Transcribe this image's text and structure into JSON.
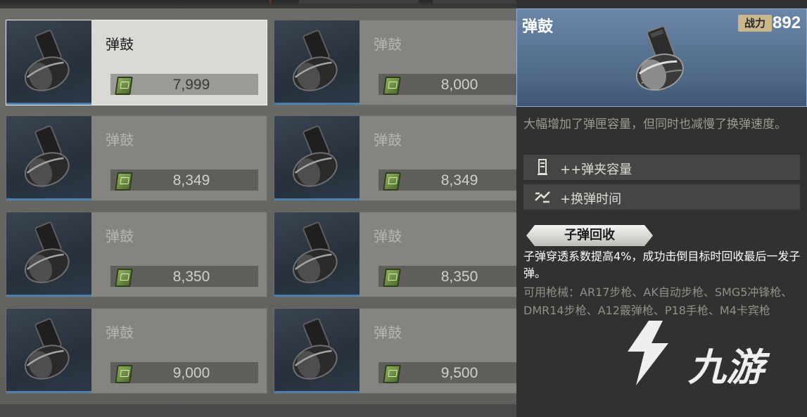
{
  "shop": {
    "items": [
      {
        "name": "弹鼓",
        "price": "7,999",
        "selected": true
      },
      {
        "name": "弹鼓",
        "price": "8,000",
        "selected": false
      },
      {
        "name": "弹鼓",
        "price": "8,349",
        "selected": false
      },
      {
        "name": "弹鼓",
        "price": "8,349",
        "selected": false
      },
      {
        "name": "弹鼓",
        "price": "8,350",
        "selected": false
      },
      {
        "name": "弹鼓",
        "price": "8,350",
        "selected": false
      },
      {
        "name": "弹鼓",
        "price": "9,000",
        "selected": false
      },
      {
        "name": "弹鼓",
        "price": "9,500",
        "selected": false
      }
    ],
    "currency_icon": "cash-icon",
    "item_icon": "drum-magazine-icon"
  },
  "detail": {
    "title": "弹鼓",
    "power_label": "战力",
    "power_value": "892",
    "description": "大幅增加了弹匣容量，但同时也减慢了换弹速度。",
    "attributes": [
      {
        "icon": "magazine-icon",
        "label": "++弹夹容量"
      },
      {
        "icon": "reload-icon",
        "label": "+换弹时间"
      }
    ],
    "perk": {
      "name": "子弹回收",
      "description": "子弹穿透系数提高4%，成功击倒目标时回收最后一发子弹。"
    },
    "compatible": "可用枪械：AR17步枪、AK自动步枪、SMG5冲锋枪、DMR14步枪、A12霰弹枪、P18手枪、M4卡宾枪"
  },
  "watermark": {
    "text": "九游",
    "icon": "jiuyou-logo-icon"
  },
  "colors": {
    "accent_blue": "#4a7fb0",
    "panel_bg": "#313130",
    "header_blue": "#5a7596",
    "power_badge": "#c9b88c"
  }
}
